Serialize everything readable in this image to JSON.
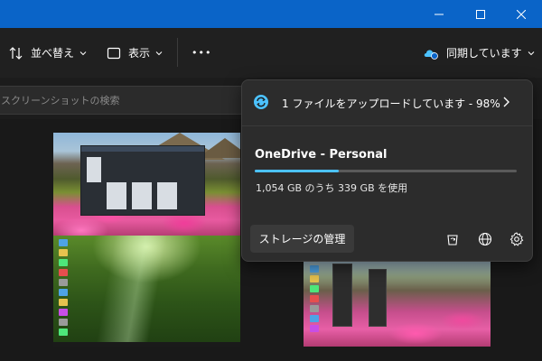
{
  "toolbar": {
    "sort_label": "並べ替え",
    "view_label": "表示",
    "more_label": "•••",
    "sync_status_label": "同期しています"
  },
  "search": {
    "placeholder": "スクリーンショットの検索"
  },
  "flyout": {
    "status_text": "1 ファイルをアップロードしています - 98%",
    "account_name": "OneDrive - Personal",
    "storage_used_gb": 339,
    "storage_total_gb": 1054,
    "storage_usage_text": "1,054 GB のうち 339 GB を使用",
    "manage_storage_label": "ストレージの管理"
  },
  "colors": {
    "title_bar": "#0a64c8",
    "accent": "#4cc2ff",
    "panel": "#2c2c2c",
    "background": "#191919"
  },
  "icons": {
    "minimize": "minimize-icon",
    "maximize": "maximize-icon",
    "close": "close-icon",
    "sort": "sort-icon",
    "view": "view-icon",
    "onedrive_sync": "onedrive-sync-icon",
    "sync": "sync-icon",
    "recycle_bin": "recycle-bin-icon",
    "web": "globe-icon",
    "settings": "gear-icon"
  }
}
